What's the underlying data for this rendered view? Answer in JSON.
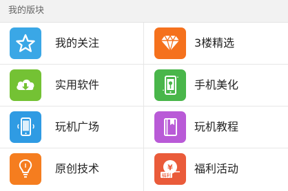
{
  "section": {
    "title": "我的版块"
  },
  "tiles": [
    {
      "label": "我的关注",
      "icon": "star-icon",
      "color": "#3aa7e6"
    },
    {
      "label": "3楼精选",
      "icon": "diamond-icon",
      "color": "#f5711d"
    },
    {
      "label": "实用软件",
      "icon": "cloud-download-icon",
      "color": "#74c234"
    },
    {
      "label": "手机美化",
      "icon": "phone-flower-icon",
      "color": "#49b64a"
    },
    {
      "label": "玩机广场",
      "icon": "smartphone-icon",
      "color": "#2f9be3"
    },
    {
      "label": "玩机教程",
      "icon": "book-icon",
      "color": "#b95ad7"
    },
    {
      "label": "原创技术",
      "icon": "lightbulb-icon",
      "color": "#f57d1f"
    },
    {
      "label": "福利活动",
      "icon": "gift-coupon-icon",
      "color": "#ea5b3a"
    }
  ]
}
